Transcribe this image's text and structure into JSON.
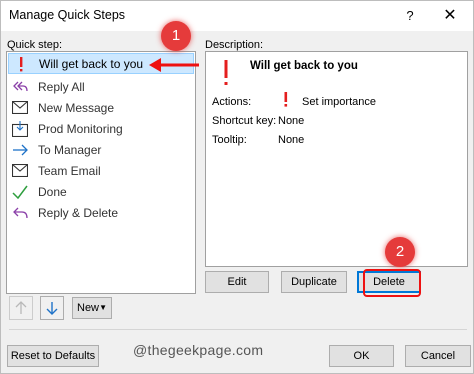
{
  "window": {
    "title": "Manage Quick Steps",
    "help_label": "?",
    "close_label": "✕"
  },
  "quick_step_label": "Quick step:",
  "description_label": "Description:",
  "quick_steps": [
    {
      "label": "Will get back to you",
      "icon": "flag-importance-icon",
      "selected": true
    },
    {
      "label": "Reply All",
      "icon": "reply-all-icon",
      "selected": false
    },
    {
      "label": "New Message",
      "icon": "envelope-icon",
      "selected": false
    },
    {
      "label": "Prod Monitoring",
      "icon": "move-to-folder-icon",
      "selected": false
    },
    {
      "label": "To Manager",
      "icon": "forward-arrow-icon",
      "selected": false
    },
    {
      "label": "Team Email",
      "icon": "envelope-icon",
      "selected": false
    },
    {
      "label": "Done",
      "icon": "checkmark-icon",
      "selected": false
    },
    {
      "label": "Reply & Delete",
      "icon": "reply-icon",
      "selected": false
    }
  ],
  "description": {
    "title": "Will get back to you",
    "actions_label": "Actions:",
    "actions_value": "Set importance",
    "shortcut_label": "Shortcut key:",
    "shortcut_value": "None",
    "tooltip_label": "Tooltip:",
    "tooltip_value": "None"
  },
  "buttons": {
    "edit": "Edit",
    "duplicate": "Duplicate",
    "delete": "Delete",
    "new": "New",
    "reset": "Reset to Defaults",
    "ok": "OK",
    "cancel": "Cancel"
  },
  "annotations": {
    "badge1": "1",
    "badge2": "2",
    "accent_color": "#e53b3b"
  },
  "watermark": "@thegeekpage.com"
}
